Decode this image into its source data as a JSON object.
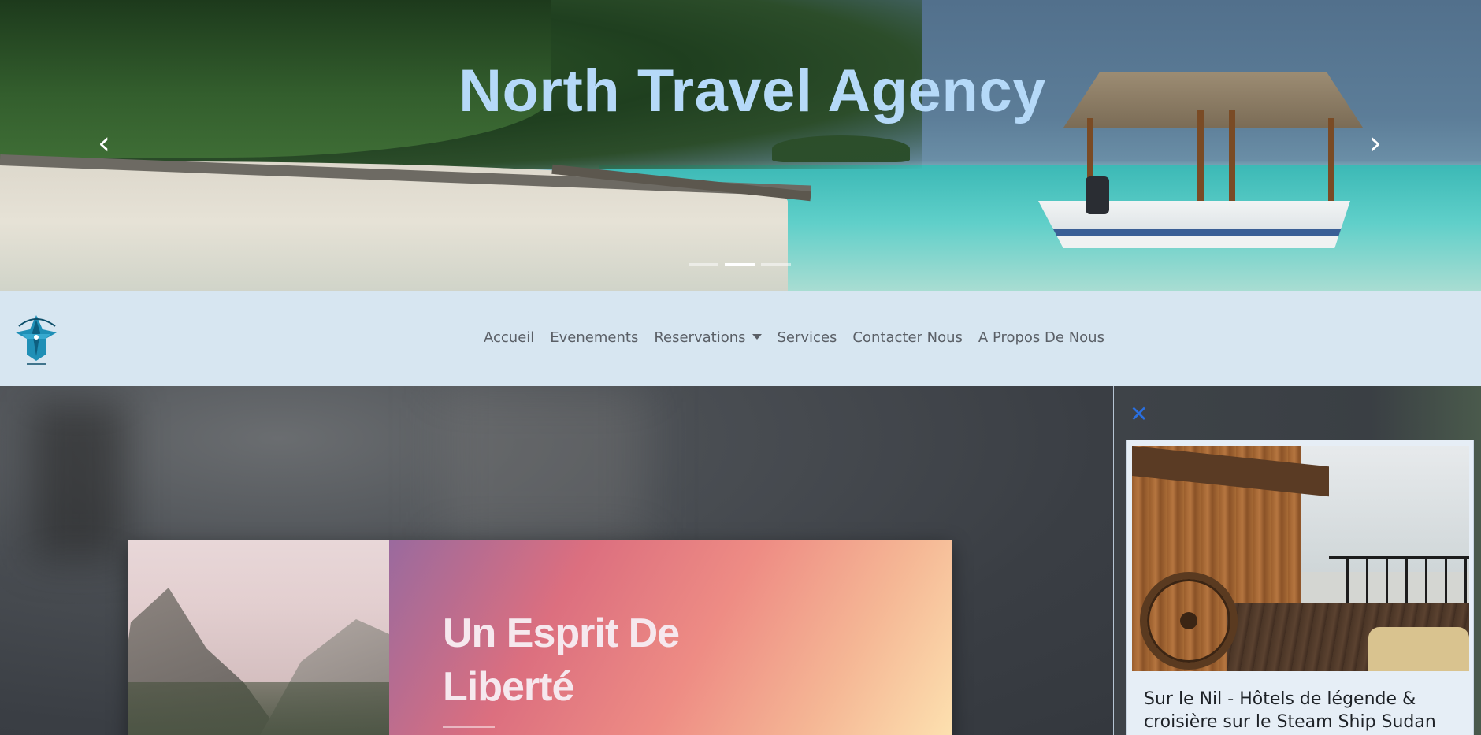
{
  "hero": {
    "title": "North Travel Agency",
    "prev_icon": "chevron-left-icon",
    "next_icon": "chevron-right-icon",
    "prev_glyph": "‹",
    "next_glyph": "›",
    "slides_count": 3,
    "active_slide": 2
  },
  "navbar": {
    "logo_alt": "North Travel Agency logo",
    "items": [
      {
        "label": "Accueil"
      },
      {
        "label": "Evenements"
      },
      {
        "label": "Reservations",
        "dropdown": true
      },
      {
        "label": "Services"
      },
      {
        "label": "Contacter Nous"
      },
      {
        "label": "A Propos De Nous"
      }
    ]
  },
  "main_card": {
    "title": "Un Esprit De Liberté"
  },
  "side_panel": {
    "close_glyph": "✕",
    "card_text": "Sur le Nil - Hôtels de légende & croisière sur le Steam Ship Sudan"
  },
  "colors": {
    "hero_title": "#b5d9f8",
    "navbar_bg": "#d7e6f1",
    "nav_text": "#5a5f66",
    "close_icon": "#2a6fe0",
    "card_gradient_start": "#9a6a9e",
    "card_gradient_end": "#fde2b0"
  }
}
